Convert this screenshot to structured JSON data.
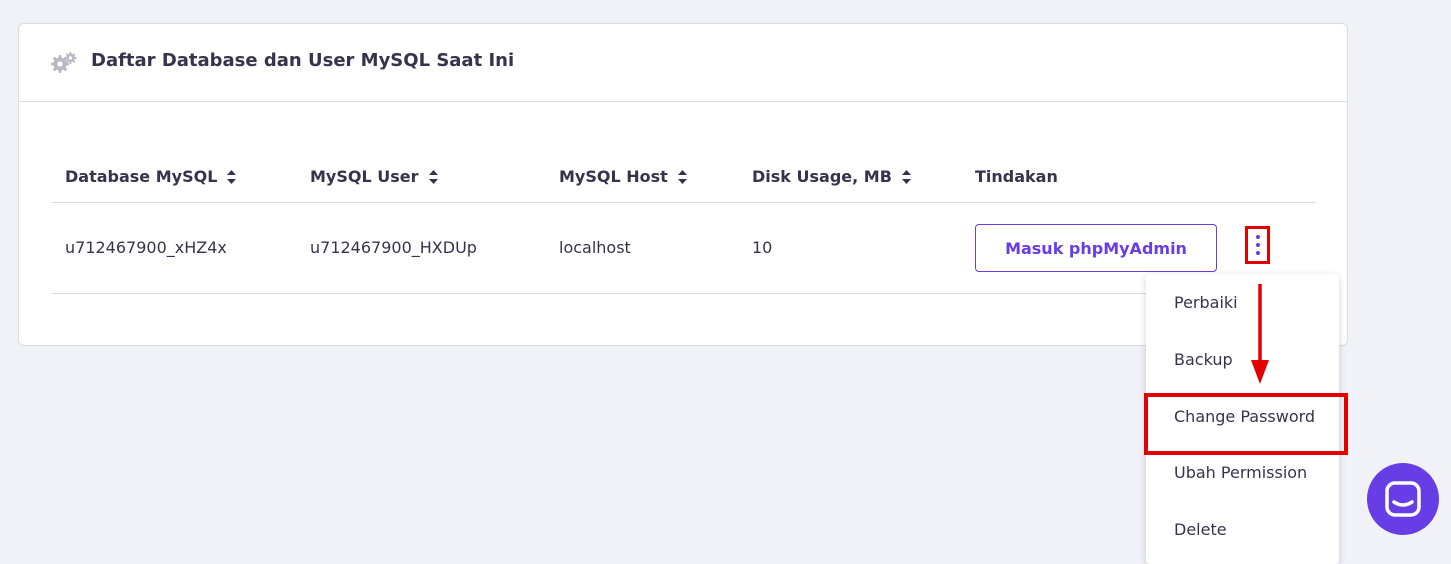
{
  "card": {
    "title": "Daftar Database dan User MySQL Saat Ini",
    "icon": "gears-icon"
  },
  "table": {
    "columns": [
      {
        "label": "Database MySQL",
        "sortable": true
      },
      {
        "label": "MySQL User",
        "sortable": true
      },
      {
        "label": "MySQL Host",
        "sortable": true
      },
      {
        "label": "Disk Usage, MB",
        "sortable": true
      },
      {
        "label": "Tindakan",
        "sortable": false
      }
    ],
    "rows": [
      {
        "database": "u712467900_xHZ4x",
        "user": "u712467900_HXDUp",
        "host": "localhost",
        "disk_usage": "10",
        "action_label": "Masuk phpMyAdmin"
      }
    ]
  },
  "dropdown": {
    "items": [
      "Perbaiki",
      "Backup",
      "Change Password",
      "Ubah Permission",
      "Delete"
    ]
  },
  "colors": {
    "accent": "#673de6",
    "annotation_red": "#e50000",
    "background": "#f1f2f7"
  }
}
